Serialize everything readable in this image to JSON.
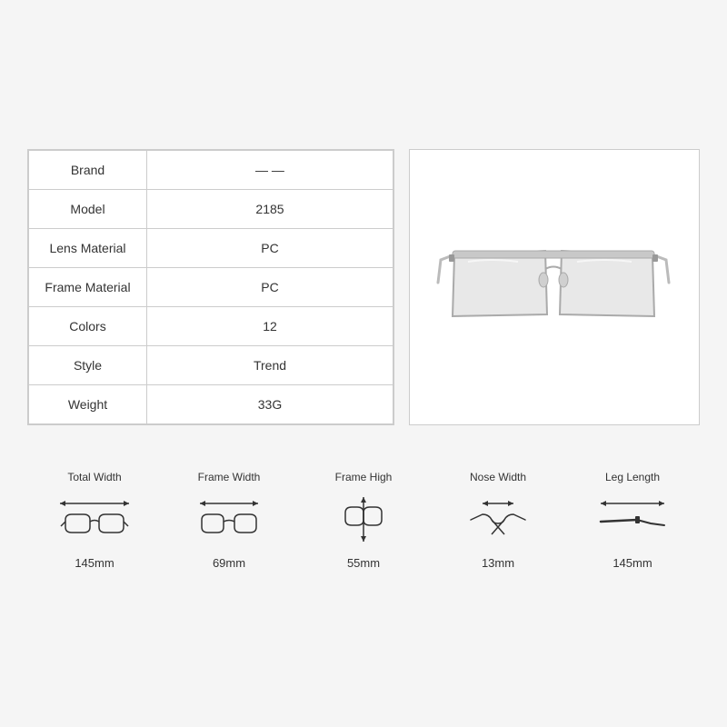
{
  "product": {
    "specs": [
      {
        "label": "Brand",
        "value": "— —"
      },
      {
        "label": "Model",
        "value": "2185"
      },
      {
        "label": "Lens Material",
        "value": "PC"
      },
      {
        "label": "Frame Material",
        "value": "PC"
      },
      {
        "label": "Colors",
        "value": "12"
      },
      {
        "label": "Style",
        "value": "Trend"
      },
      {
        "label": "Weight",
        "value": "33G"
      }
    ],
    "measurements": [
      {
        "label": "Total Width",
        "value": "145mm",
        "icon": "total-width"
      },
      {
        "label": "Frame Width",
        "value": "69mm",
        "icon": "frame-width"
      },
      {
        "label": "Frame High",
        "value": "55mm",
        "icon": "frame-high"
      },
      {
        "label": "Nose Width",
        "value": "13mm",
        "icon": "nose-width"
      },
      {
        "label": "Leg Length",
        "value": "145mm",
        "icon": "leg-length"
      }
    ]
  }
}
